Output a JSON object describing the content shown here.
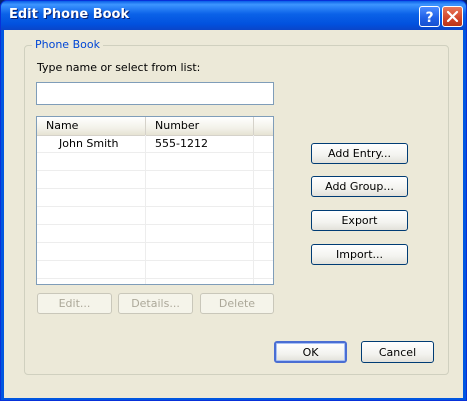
{
  "window": {
    "title": "Edit Phone Book"
  },
  "titlebar": {
    "help_icon": "help-question-icon",
    "close_icon": "close-x-icon"
  },
  "group": {
    "label": "Phone Book"
  },
  "search": {
    "label": "Type name or select from list:",
    "value": "",
    "placeholder": ""
  },
  "list": {
    "columns": [
      "Name",
      "Number"
    ],
    "rows": [
      {
        "name": "John Smith",
        "number": "555-1212"
      }
    ]
  },
  "buttons": {
    "add_entry": "Add Entry...",
    "add_group": "Add Group...",
    "export": "Export",
    "import": "Import...",
    "edit": "Edit...",
    "details": "Details...",
    "delete": "Delete",
    "ok": "OK",
    "cancel": "Cancel"
  }
}
